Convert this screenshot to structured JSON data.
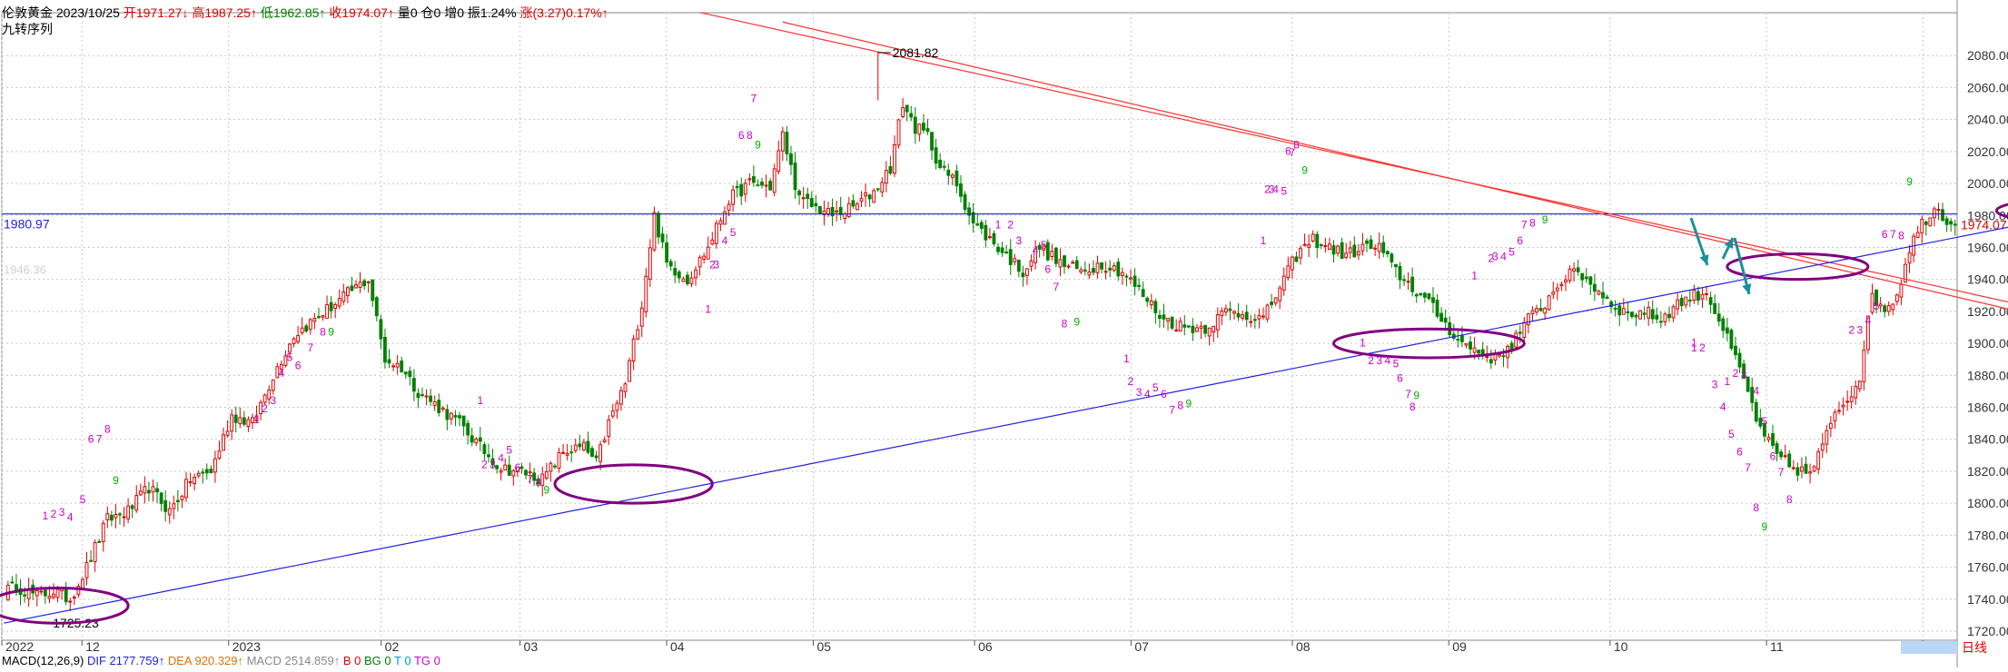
{
  "header": {
    "instrument": "伦敦黄金",
    "date": "2023/10/25",
    "open": "开1971.27↓",
    "high": "高1987.25↑",
    "low": "低1962.85↑",
    "close": "收1974.07↑",
    "volume": "量0",
    "position": "仓0",
    "increase": "增0",
    "amplitude": "振1.24%",
    "change": "涨(3.27)0.17%↑",
    "indicator": "九转序列"
  },
  "macd": {
    "label": "MACD(12,26,9)",
    "dif": "DIF 2177.759↑",
    "dea": "DEA 920.329↑",
    "macd": "MACD 2514.859↑",
    "b": "B 0",
    "bg": "BG 0",
    "t": "T 0",
    "tg": "TG 0"
  },
  "colors": {
    "up": "#e00000",
    "down": "#008000",
    "trend_red": "#ff3030",
    "trend_blue": "#2020e0",
    "ellipse": "#800080",
    "arrow": "#1a8fa0",
    "grid": "#c8c8c8",
    "td_up": "#cc00cc",
    "td_9": "#00b000"
  },
  "chart_data": {
    "type": "candlestick",
    "ylim": [
      1720,
      2100
    ],
    "y_ticks": [
      "2080.00",
      "2060.00",
      "2040.00",
      "2020.00",
      "2000.00",
      "1980.00",
      "1960.00",
      "1940.00",
      "1920.00",
      "1900.00",
      "1880.00",
      "1860.00",
      "1840.00",
      "1820.00",
      "1800.00",
      "1780.00",
      "1760.00",
      "1740.00",
      "1720.00"
    ],
    "x_ticks": [
      "2022",
      "12",
      "2023",
      "02",
      "03",
      "04",
      "05",
      "06",
      "07",
      "08",
      "09",
      "10",
      "11",
      "12"
    ],
    "period_label": "日线",
    "price_labels": {
      "high_mark": "2081.82",
      "low_mark": "1725.23",
      "hline": "1980.97",
      "last": "1974.07",
      "faint": "1946.36"
    },
    "hline_value": 1980.97,
    "last_value": 1974.07,
    "anchors": [
      [
        0,
        1745
      ],
      [
        3,
        1748
      ],
      [
        8,
        1742
      ],
      [
        12,
        1745
      ],
      [
        16,
        1740
      ],
      [
        20,
        1760
      ],
      [
        25,
        1790
      ],
      [
        30,
        1795
      ],
      [
        35,
        1810
      ],
      [
        40,
        1795
      ],
      [
        45,
        1815
      ],
      [
        50,
        1820
      ],
      [
        55,
        1855
      ],
      [
        60,
        1850
      ],
      [
        65,
        1880
      ],
      [
        70,
        1905
      ],
      [
        75,
        1915
      ],
      [
        80,
        1925
      ],
      [
        85,
        1935
      ],
      [
        88,
        1940
      ],
      [
        92,
        1890
      ],
      [
        96,
        1885
      ],
      [
        100,
        1870
      ],
      [
        105,
        1860
      ],
      [
        110,
        1850
      ],
      [
        115,
        1835
      ],
      [
        120,
        1822
      ],
      [
        125,
        1820
      ],
      [
        130,
        1815
      ],
      [
        135,
        1832
      ],
      [
        140,
        1835
      ],
      [
        143,
        1825
      ],
      [
        146,
        1850
      ],
      [
        150,
        1875
      ],
      [
        154,
        1925
      ],
      [
        157,
        1980
      ],
      [
        160,
        1950
      ],
      [
        165,
        1940
      ],
      [
        170,
        1960
      ],
      [
        175,
        1990
      ],
      [
        180,
        2000
      ],
      [
        185,
        1998
      ],
      [
        188,
        2030
      ],
      [
        192,
        1990
      ],
      [
        196,
        1985
      ],
      [
        200,
        1980
      ],
      [
        205,
        1985
      ],
      [
        210,
        1995
      ],
      [
        214,
        2010
      ],
      [
        217,
        2050
      ],
      [
        220,
        2035
      ],
      [
        223,
        2030
      ],
      [
        226,
        2010
      ],
      [
        230,
        2000
      ],
      [
        234,
        1975
      ],
      [
        238,
        1965
      ],
      [
        242,
        1955
      ],
      [
        246,
        1945
      ],
      [
        250,
        1960
      ],
      [
        255,
        1950
      ],
      [
        260,
        1945
      ],
      [
        265,
        1950
      ],
      [
        270,
        1945
      ],
      [
        275,
        1930
      ],
      [
        280,
        1915
      ],
      [
        285,
        1910
      ],
      [
        290,
        1910
      ],
      [
        295,
        1920
      ],
      [
        300,
        1918
      ],
      [
        304,
        1915
      ],
      [
        308,
        1935
      ],
      [
        312,
        1955
      ],
      [
        316,
        1965
      ],
      [
        320,
        1960
      ],
      [
        324,
        1955
      ],
      [
        328,
        1960
      ],
      [
        332,
        1960
      ],
      [
        336,
        1945
      ],
      [
        340,
        1935
      ],
      [
        344,
        1925
      ],
      [
        348,
        1912
      ],
      [
        352,
        1900
      ],
      [
        356,
        1895
      ],
      [
        360,
        1890
      ],
      [
        364,
        1900
      ],
      [
        368,
        1915
      ],
      [
        372,
        1925
      ],
      [
        376,
        1940
      ],
      [
        380,
        1945
      ],
      [
        384,
        1935
      ],
      [
        388,
        1925
      ],
      [
        392,
        1918
      ],
      [
        396,
        1920
      ],
      [
        400,
        1915
      ],
      [
        404,
        1925
      ],
      [
        408,
        1930
      ],
      [
        411,
        1932
      ],
      [
        414,
        1915
      ],
      [
        418,
        1890
      ],
      [
        421,
        1870
      ],
      [
        424,
        1845
      ],
      [
        428,
        1830
      ],
      [
        432,
        1822
      ],
      [
        436,
        1818
      ],
      [
        439,
        1835
      ],
      [
        442,
        1858
      ],
      [
        445,
        1865
      ],
      [
        448,
        1880
      ],
      [
        451,
        1930
      ],
      [
        454,
        1922
      ],
      [
        457,
        1930
      ],
      [
        460,
        1960
      ],
      [
        463,
        1975
      ],
      [
        466,
        1985
      ],
      [
        469,
        1978
      ],
      [
        471,
        1974
      ]
    ],
    "trend_lines": [
      {
        "color": "red",
        "from": [
          168,
          2107
        ],
        "to": [
          590,
          1865
        ]
      },
      {
        "color": "red",
        "from": [
          188,
          2101
        ],
        "to": [
          590,
          1857
        ]
      },
      {
        "color": "blue",
        "from": [
          0,
          1725
        ],
        "to": [
          590,
          2027
        ]
      }
    ],
    "ellipses": [
      {
        "center": [
          13,
          1736
        ],
        "rx": 17,
        "ry_value": 11
      },
      {
        "center": [
          152,
          1812
        ],
        "rx": 19,
        "ry_value": 12
      },
      {
        "center": [
          344,
          1900
        ],
        "rx": 23,
        "ry_value": 9
      },
      {
        "center": [
          433,
          1948
        ],
        "rx": 17,
        "ry_value": 8
      },
      {
        "center": [
          503,
          1983
        ],
        "rx": 22,
        "ry_value": 8
      }
    ],
    "td_labels": [
      [
        10,
        1790,
        "1"
      ],
      [
        12,
        1791,
        "2"
      ],
      [
        14,
        1792,
        "3"
      ],
      [
        16,
        1790,
        "4"
      ],
      [
        19,
        1800,
        "5"
      ],
      [
        21,
        1837,
        "6"
      ],
      [
        23,
        1837,
        "7"
      ],
      [
        25,
        1844,
        "8"
      ],
      [
        27,
        1812,
        "9"
      ],
      [
        61,
        1850,
        "1"
      ],
      [
        63,
        1858,
        "2"
      ],
      [
        65,
        1862,
        "3"
      ],
      [
        67,
        1879,
        "4"
      ],
      [
        69,
        1889,
        "5"
      ],
      [
        71,
        1884,
        "6"
      ],
      [
        74,
        1895,
        "7"
      ],
      [
        76,
        1904,
        "8"
      ],
      [
        78,
        1904,
        "9"
      ],
      [
        115,
        1862,
        "1"
      ],
      [
        116,
        1823,
        "2"
      ],
      [
        118,
        1823,
        "3"
      ],
      [
        120,
        1825,
        "4"
      ],
      [
        122,
        1831,
        "5"
      ],
      [
        124,
        1820,
        "6"
      ],
      [
        127,
        1812,
        "7"
      ],
      [
        129,
        1810,
        "8"
      ],
      [
        131,
        1805,
        "9"
      ],
      [
        170,
        1918,
        "1"
      ],
      [
        172,
        1950
      ],
      [
        174,
        1952
      ],
      [
        176,
        1942
      ],
      [
        178,
        1938
      ],
      [
        180,
        1944
      ],
      [
        182,
        2048,
        "7"
      ],
      [
        182,
        2030,
        "6"
      ],
      [
        185,
        2029,
        "8"
      ],
      [
        187,
        2019,
        "9"
      ],
      [
        170,
        1918,
        "1"
      ],
      [
        171,
        1948,
        "2"
      ],
      [
        172,
        1937,
        "3"
      ],
      [
        174,
        1930,
        "4"
      ],
      [
        176,
        1967,
        "5"
      ],
      [
        178,
        1958,
        "6"
      ],
      [
        180,
        2028,
        "8"
      ],
      [
        182,
        2022,
        "9"
      ]
    ],
    "last_label_color": "red"
  }
}
